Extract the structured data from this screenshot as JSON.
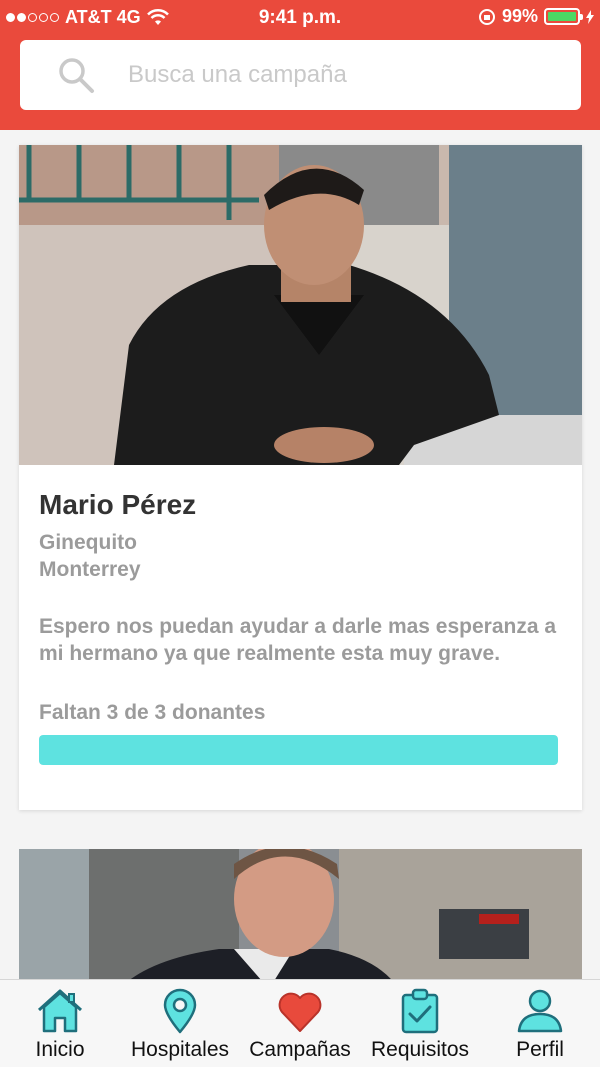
{
  "status_bar": {
    "carrier": "AT&T 4G",
    "time": "9:41 p.m.",
    "battery": "99%",
    "battery_level": 0.99
  },
  "search": {
    "placeholder": "Busca una campaña"
  },
  "campaigns": [
    {
      "name": "Mario Pérez",
      "location_line1": "Ginequito",
      "location_line2": "Monterrey",
      "description": "Espero nos puedan ayudar a darle mas esperanza a mi hermano ya que realmente esta muy grave.",
      "donors_needed": "Faltan 3 de 3 donantes",
      "progress": 1.0
    }
  ],
  "tabs": [
    {
      "label": "Inicio",
      "icon": "home-icon"
    },
    {
      "label": "Hospitales",
      "icon": "map-pin-icon"
    },
    {
      "label": "Campañas",
      "icon": "heart-icon"
    },
    {
      "label": "Requisitos",
      "icon": "clipboard-check-icon"
    },
    {
      "label": "Perfil",
      "icon": "user-icon"
    }
  ],
  "colors": {
    "header": "#ea4a3c",
    "accent": "#5ee2e0",
    "heart": "#e84a3c",
    "battery": "#4cd964"
  }
}
